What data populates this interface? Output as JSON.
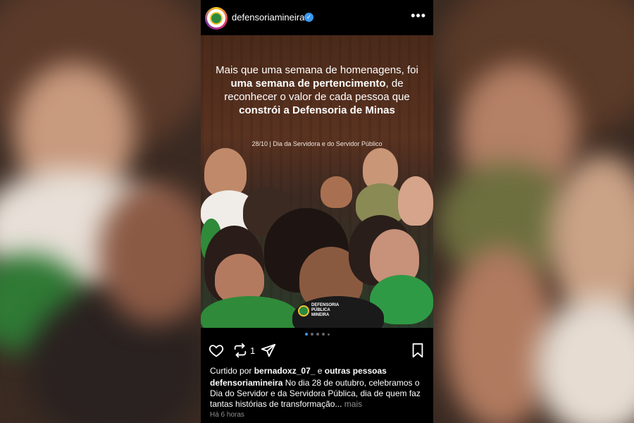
{
  "profile": {
    "username": "defensoriamineira",
    "verified_icon": "verified-check-icon",
    "more_icon": "more-horizontal-icon"
  },
  "post": {
    "headline_part1": "Mais que uma semana de homenagens, foi ",
    "headline_bold1": "uma semana de pertencimento",
    "headline_part2": ", de reconhecer o valor de cada pessoa que ",
    "headline_bold2": "constrói a Defensoria de Minas",
    "subline": "28/10 | Dia da Servidora e do Servidor Público",
    "logo_text_line1": "DEFENSORIA",
    "logo_text_line2": "PÚBLICA",
    "logo_text_line3": "MINEIRA",
    "carousel_count": 5,
    "carousel_active": 1,
    "colors": {
      "brand_green": "#2b8a3e",
      "brand_yellow": "#f2c230",
      "active_dot": "#3897f0"
    }
  },
  "actions": {
    "like_icon": "heart-icon",
    "repost_icon": "repost-icon",
    "repost_count": "1",
    "share_icon": "send-icon",
    "save_icon": "bookmark-icon"
  },
  "likes": {
    "prefix": "Curtido por ",
    "user": "bernadoxz_07_",
    "suffix": " e ",
    "others": "outras pessoas"
  },
  "caption": {
    "author": "defensoriamineira",
    "text": " No dia 28 de outubro, celebramos o Dia do Servidor e da Servidora Pública, dia de quem faz tantas histórias de transformação...",
    "more": " mais"
  },
  "timestamp": "Há 6 horas"
}
